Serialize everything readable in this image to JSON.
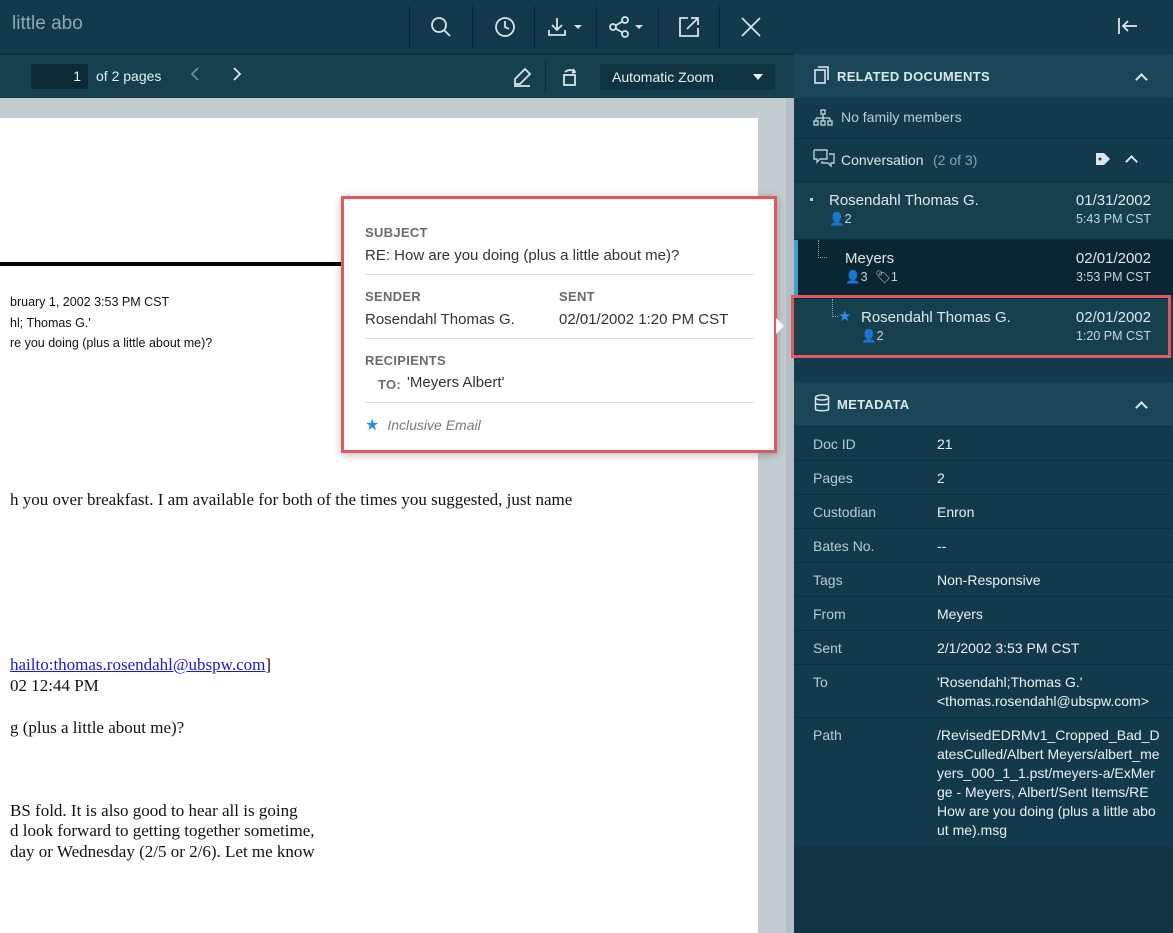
{
  "viewer": {
    "doc_title": "little abo",
    "page_current": "1",
    "page_of": "of 2 pages",
    "zoom": "Automatic Zoom"
  },
  "document": {
    "header_lines": [
      "bruary 1, 2002 3:53 PM CST",
      "hl; Thomas G.'",
      "re you doing (plus a little about me)?"
    ],
    "body_line_1": "h you over breakfast.  I am available for both of the times you suggested, just name",
    "mailto_text": "hailto:thomas.rosendahl@ubspw.com",
    "mailto_suffix": "]",
    "date_line": "02 12:44 PM",
    "subject_line": "g (plus a little about me)?",
    "para_lines": [
      "BS fold. It is also good to hear all is going",
      "d look forward to getting together sometime,",
      "day or Wednesday (2/5 or 2/6). Let me know"
    ]
  },
  "popup": {
    "subject_label": "SUBJECT",
    "subject_value": "RE: How are you doing (plus a little about me)?",
    "sender_label": "SENDER",
    "sender_value": "Rosendahl Thomas G.",
    "sent_label": "SENT",
    "sent_value": "02/01/2002 1:20 PM CST",
    "recipients_label": "RECIPIENTS",
    "to_label": "TO:",
    "to_value": "'Meyers Albert'",
    "inclusive_label": "Inclusive Email"
  },
  "related": {
    "title": "RELATED DOCUMENTS",
    "family": "No family members",
    "conversation_label": "Conversation",
    "conversation_count": "(2 of 3)",
    "items": [
      {
        "name": "Rosendahl Thomas G.",
        "date": "01/31/2002",
        "time": "5:43 PM CST",
        "people": "2"
      },
      {
        "name": "Meyers",
        "date": "02/01/2002",
        "time": "3:53 PM CST",
        "people": "3",
        "tags": "1"
      },
      {
        "name": "Rosendahl Thomas G.",
        "date": "02/01/2002",
        "time": "1:20 PM CST",
        "people": "2"
      }
    ]
  },
  "metadata": {
    "title": "METADATA",
    "rows": [
      {
        "label": "Doc ID",
        "value": "21"
      },
      {
        "label": "Pages",
        "value": "2"
      },
      {
        "label": "Custodian",
        "value": "Enron"
      },
      {
        "label": "Bates No.",
        "value": "--"
      },
      {
        "label": "Tags",
        "value": "Non-Responsive"
      },
      {
        "label": "From",
        "value": "Meyers"
      },
      {
        "label": "Sent",
        "value": "2/1/2002 3:53 PM CST"
      },
      {
        "label": "To",
        "value": "'Rosendahl;Thomas G.' <thomas.rosendahl@ubspw.com>"
      },
      {
        "label": "Path",
        "value": "/RevisedEDRMv1_Cropped_Bad_DatesCulled/Albert Meyers/albert_meyers_000_1_1.pst/meyers-a/ExMerge - Meyers, Albert/Sent Items/RE How are you doing (plus a little about me).msg"
      }
    ]
  },
  "colors": {
    "panel_bg": "#123a4a",
    "highlight_border": "#e4585b",
    "star": "#2a8ef0",
    "selected_bar": "#3aa3c8"
  },
  "icons": [
    "search-icon",
    "history-icon",
    "download-icon",
    "share-icon",
    "popout-icon",
    "close-icon",
    "highlighter-icon",
    "rotate-icon",
    "collapse-panel-icon",
    "document-icon",
    "hierarchy-icon",
    "conversation-icon",
    "tag-icon",
    "person-icon",
    "star-icon",
    "database-icon"
  ]
}
